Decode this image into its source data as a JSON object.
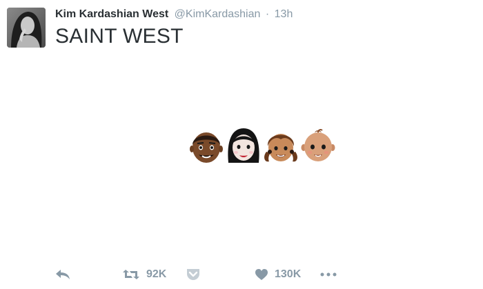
{
  "tweet": {
    "author_name": "Kim Kardashian West",
    "author_handle": "@KimKardashian",
    "separator": "·",
    "time": "13h",
    "text": "SAINT WEST"
  },
  "emoji": [
    "man-dark-skin",
    "woman-black-hair",
    "girl-pigtails",
    "baby"
  ],
  "actions": {
    "reply_icon": "reply-icon",
    "retweet_icon": "retweet-icon",
    "retweet_count": "92K",
    "pocket_icon": "pocket-icon",
    "like_icon": "heart-icon",
    "like_count": "130K",
    "more_icon": "more-icon"
  },
  "colors": {
    "action_gray": "#8899a6",
    "text": "#292f33",
    "handle": "#8899a6"
  }
}
